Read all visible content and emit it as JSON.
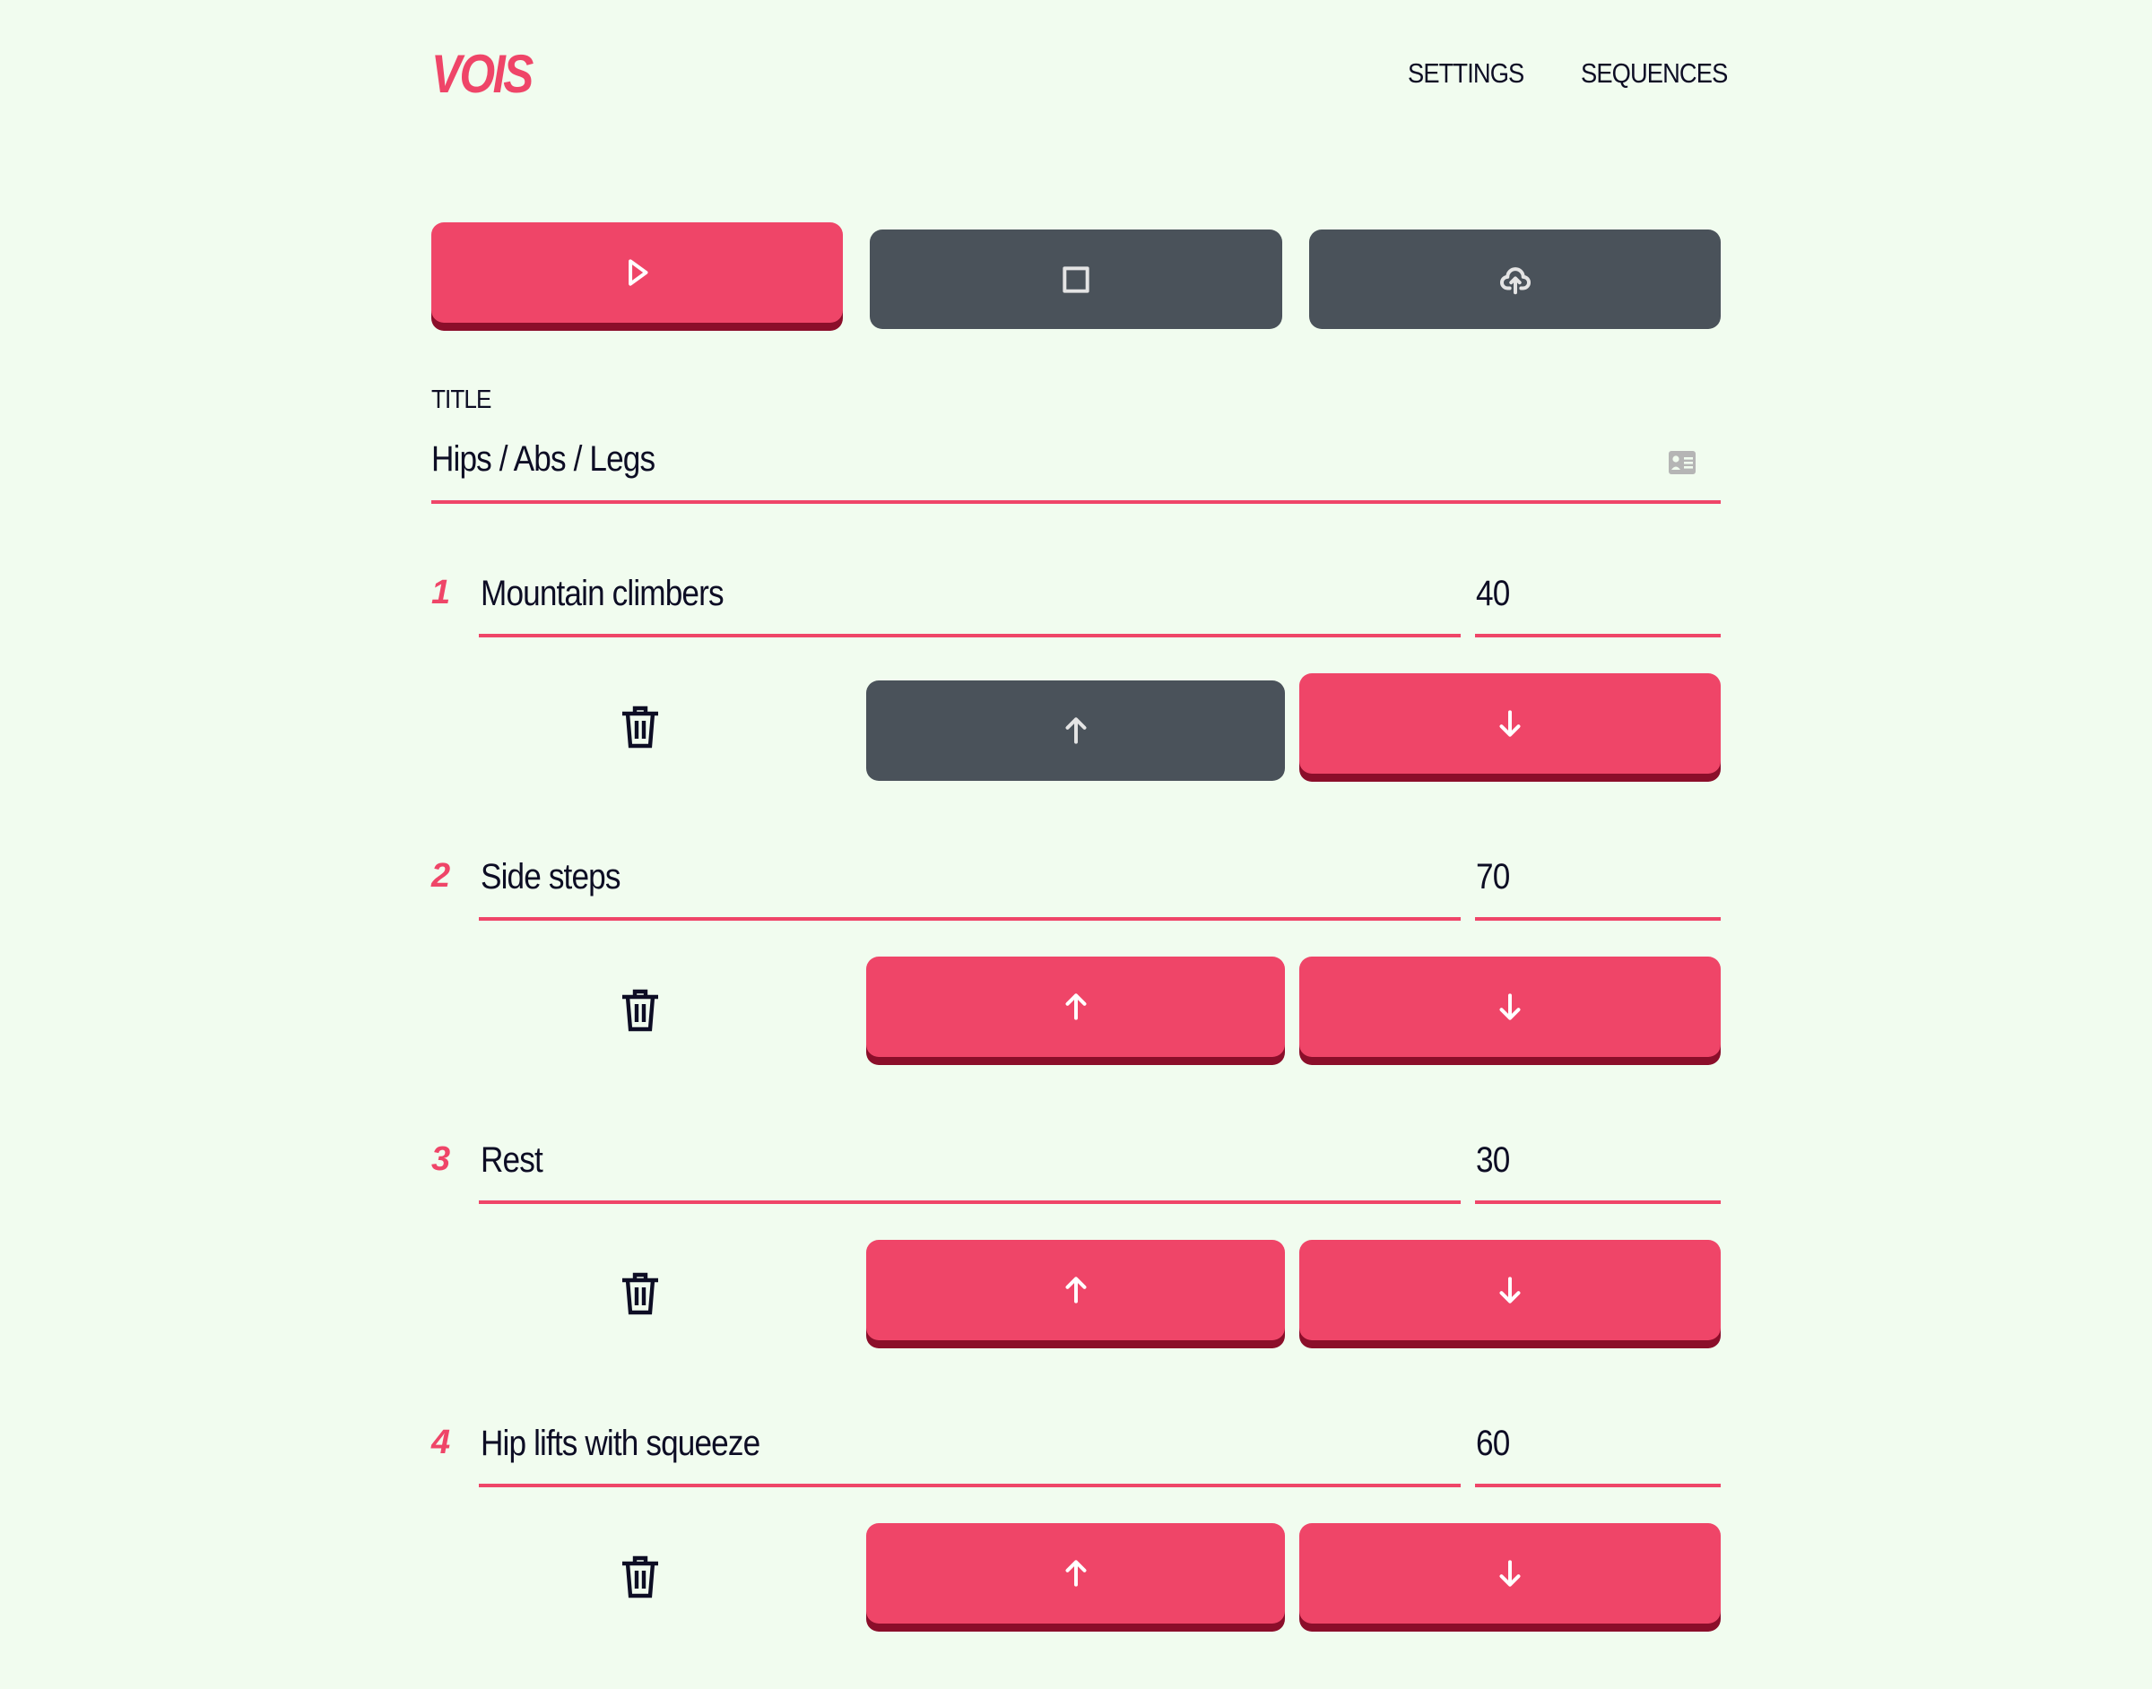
{
  "header": {
    "logo": "VOIS",
    "nav": [
      {
        "label": "SETTINGS"
      },
      {
        "label": "SEQUENCES"
      }
    ]
  },
  "toolbar": {
    "play_icon": "play-icon",
    "stop_icon": "stop-icon",
    "upload_icon": "cloud-upload-icon"
  },
  "title_field": {
    "label": "TITLE",
    "value": "Hips / Abs / Legs",
    "icon": "contact-card-icon"
  },
  "colors": {
    "accent": "#ef4568",
    "accent_dark": "#8b0e2a",
    "neutral": "#4a525a",
    "background": "#f1fcef"
  },
  "exercises": [
    {
      "number": "1",
      "name": "Mountain climbers",
      "duration": "40",
      "up_enabled": false
    },
    {
      "number": "2",
      "name": "Side steps",
      "duration": "70",
      "up_enabled": true
    },
    {
      "number": "3",
      "name": "Rest",
      "duration": "30",
      "up_enabled": true
    },
    {
      "number": "4",
      "name": "Hip lifts with squeeze",
      "duration": "60",
      "up_enabled": true
    }
  ]
}
